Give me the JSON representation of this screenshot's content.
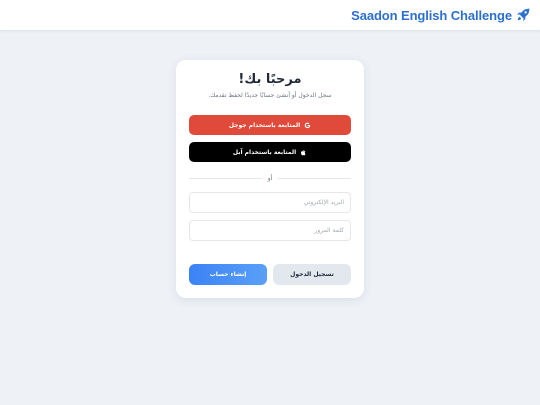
{
  "header": {
    "brand_title": "Saadon English Challenge",
    "brand_icon": "rocket-icon",
    "brand_color": "#2d6fce"
  },
  "login_card": {
    "title": "مرحبًا بك!",
    "subtitle": "سجل الدخول أو أنشئ حسابًا جديدًا لحفظ تقدمك.",
    "google_button": {
      "label": "المتابعة باستخدام جوجل",
      "icon": "google-icon",
      "color": "#e04a3a"
    },
    "apple_button": {
      "label": "المتابعة باستخدام آبل",
      "icon": "apple-icon",
      "color": "#000000"
    },
    "divider_text": "أو",
    "email_field": {
      "value": "",
      "placeholder": "البريد الإلكتروني"
    },
    "password_field": {
      "value": "",
      "placeholder": "كلمة المرور"
    },
    "login_button": {
      "label": "تسجيل الدخول"
    },
    "signup_button": {
      "label": "إنشاء حساب",
      "color": "#3b82f6"
    }
  }
}
